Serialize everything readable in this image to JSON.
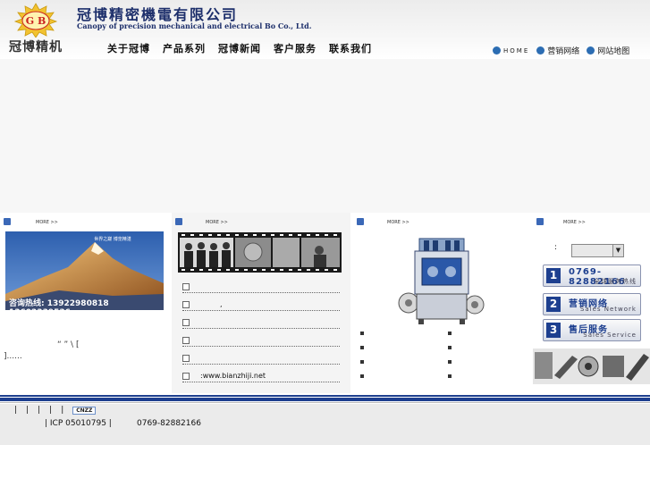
{
  "header": {
    "logo_letters": "G B",
    "logo_text": "冠博精机",
    "company_cn": "冠博精密機電有限公司",
    "company_en": "Canopy of precision mechanical and electrical Bo Co., Ltd."
  },
  "nav": {
    "items": [
      "关于冠博",
      "产品系列",
      "冠博新闻",
      "客户服务",
      "联系我们"
    ]
  },
  "top_links": {
    "home": "HOME",
    "sales_network": "营销网络",
    "site_map": "网站地图"
  },
  "col1": {
    "more": "MORE >>",
    "banner_caption": "世界之巅  博览精湛",
    "hotline": "咨询热线: 13922980818  13602339536",
    "intro": "   “    ”              \\ [",
    "intro_more": "]......"
  },
  "col2": {
    "more": "MORE >>",
    "news": [
      "",
      ",",
      "",
      "",
      "",
      ":www.bianzhiji.net"
    ]
  },
  "col3": {
    "more": "MORE >>"
  },
  "col4": {
    "more": "MORE >>",
    "lang_label": ":",
    "lang_arrow": "▼",
    "services": [
      {
        "num": "1",
        "title": "0769-82882166",
        "sub": "全球服务热线"
      },
      {
        "num": "2",
        "title": "营销网络",
        "sub": "Sales Network"
      },
      {
        "num": "3",
        "title": "售后服务",
        "sub": "Sales Service"
      }
    ]
  },
  "footer": {
    "links": [
      "|",
      "|",
      "|",
      "|",
      "|"
    ],
    "cnzz": "CNZZ",
    "icp": "| ICP  05010795 |",
    "phone": "0769-82882166"
  },
  "colors": {
    "brand_blue": "#1d3f8f",
    "nav_text": "#111111",
    "footer_bg": "#ebebeb"
  }
}
